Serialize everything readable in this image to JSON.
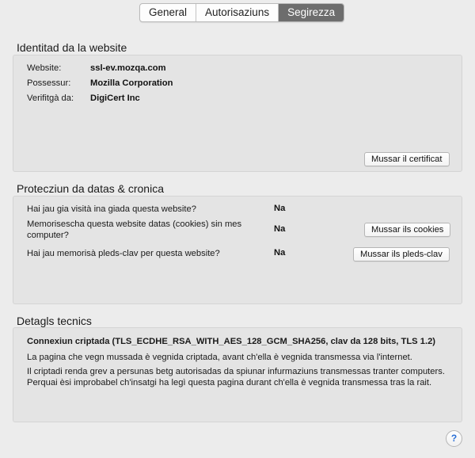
{
  "tabs": [
    {
      "label": "General",
      "active": false
    },
    {
      "label": "Autorisaziuns",
      "active": false
    },
    {
      "label": "Segirezza",
      "active": true
    }
  ],
  "identity": {
    "title": "Identitad da la website",
    "rows": [
      {
        "label": "Website:",
        "value": "ssl-ev.mozqa.com"
      },
      {
        "label": "Possessur:",
        "value": "Mozilla Corporation"
      },
      {
        "label": "Verifitgà da:",
        "value": "DigiCert Inc"
      }
    ],
    "view_cert_button": "Mussar il certificat"
  },
  "privacy": {
    "title": "Protecziun da datas & cronica",
    "rows": [
      {
        "question": "Hai jau gia visità ina giada questa website?",
        "answer": "Na"
      },
      {
        "question": "Memorisescha questa website datas (cookies) sin mes computer?",
        "answer": "Na",
        "button": "Mussar ils cookies"
      },
      {
        "question": "Hai jau memorisà pleds-clav per questa website?",
        "answer": "Na",
        "button": "Mussar ils pleds-clav"
      }
    ]
  },
  "technical": {
    "title": "Detagls tecnics",
    "headline": "Connexiun criptada (TLS_ECDHE_RSA_WITH_AES_128_GCM_SHA256, clav da 128 bits, TLS 1.2)",
    "line1": "La pagina che vegn mussada è vegnida criptada, avant ch'ella è vegnida transmessa via l'internet.",
    "line2": "Il criptadi renda grev a persunas betg autorisadas da spiunar infurmaziuns transmessas tranter computers. Perquai èsi improbabel ch'insatgi ha legì questa pagina durant ch'ella è vegnida transmessa tras la rait."
  },
  "help": {
    "label": "?",
    "icon": "help-icon"
  },
  "colors": {
    "active_tab": "#6d6d6d",
    "help_accent": "#2a6fd6"
  }
}
